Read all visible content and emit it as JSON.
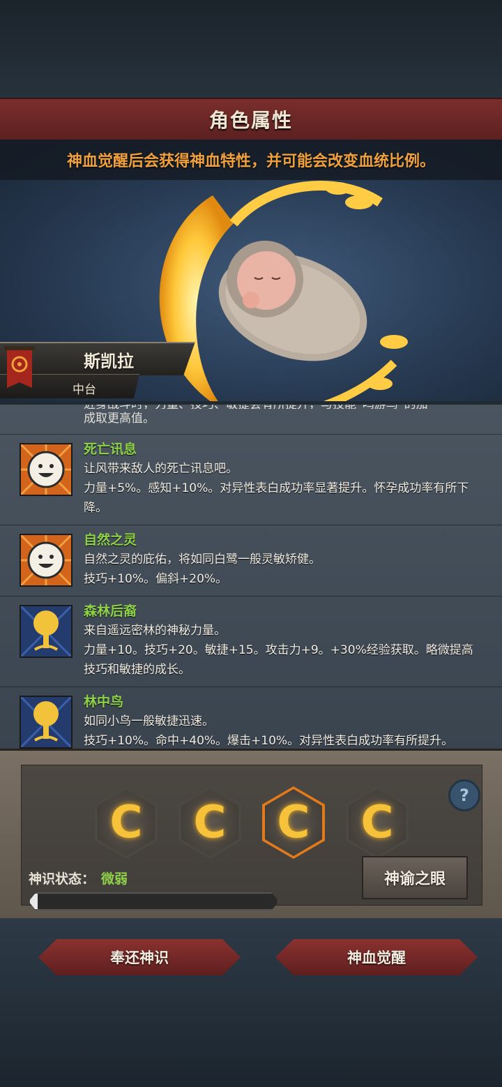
{
  "window": {
    "title": "角色属性"
  },
  "hint": "神血觉醒后会获得神血特性，并可能会改变血统比例。",
  "character": {
    "name": "斯凯拉",
    "position": "中台"
  },
  "traits": {
    "cut_top": "近身战斗时，力量、技巧、敏捷会有所提升，与技能“鸣游鸟”的加",
    "cut_line": "成取更高值。",
    "items": [
      {
        "name": "死亡讯息",
        "desc": "让风带来敌人的死亡讯息吧。",
        "stat": "力量+5%。感知+10%。对异性表白成功率显著提升。怀孕成功率有所下降。",
        "icon": "smiley-icon"
      },
      {
        "name": "自然之灵",
        "desc": "自然之灵的庇佑，将如同白鹭一般灵敏矫健。",
        "stat": "技巧+10%。偏斜+20%。",
        "icon": "smiley-icon"
      },
      {
        "name": "森林后裔",
        "desc": "来自遥远密林的神秘力量。",
        "stat": "力量+10。技巧+20。敏捷+15。攻击力+9。+30%经验获取。略微提高技巧和敏捷的成长。",
        "icon": "tree-icon"
      },
      {
        "name": "林中鸟",
        "desc": "如同小鸟一般敏捷迅速。",
        "stat": "技巧+10%。命中+40%。爆击+10%。对异性表白成功率有所提升。",
        "icon": "tree-icon"
      }
    ]
  },
  "divine": {
    "help": "?",
    "status_label": "神识状态：",
    "status_value": "微弱",
    "progress": 0.03,
    "eye_button": "神谕之眼",
    "slots": [
      {
        "glyph": "C",
        "selected": false
      },
      {
        "glyph": "C",
        "selected": false
      },
      {
        "glyph": "C",
        "selected": true
      },
      {
        "glyph": "C",
        "selected": false
      }
    ]
  },
  "actions": {
    "return": "奉还神识",
    "awaken": "神血觉醒"
  },
  "colors": {
    "accent_orange": "#f0a03c",
    "trait_green": "#8fd24a",
    "banner_red": "#7a2e2c"
  }
}
